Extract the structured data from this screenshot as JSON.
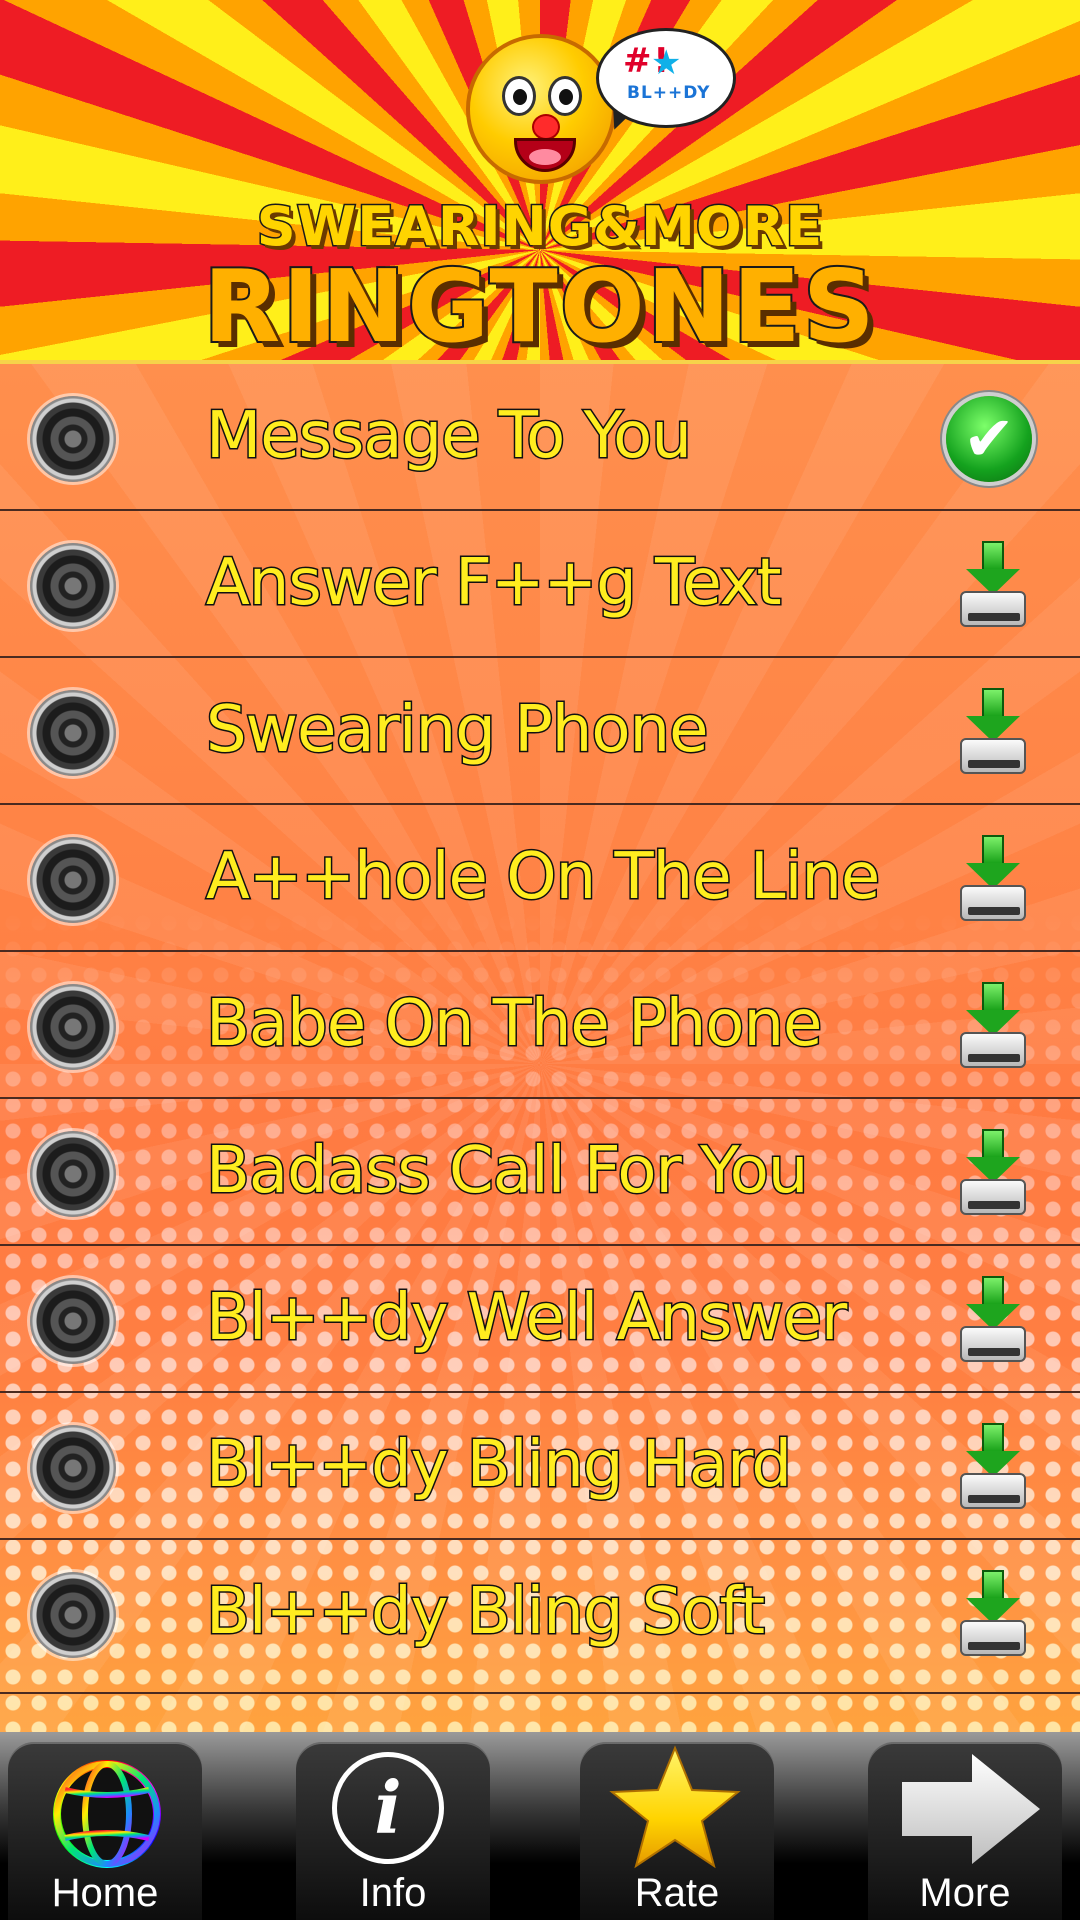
{
  "header": {
    "logo_line1": "SWEARING&MORE",
    "logo_line2": "RINGTONES",
    "bubble_symbols": "#!",
    "bubble_word": "BL++DY"
  },
  "ringtones": [
    {
      "title": "Message To You",
      "status": "selected",
      "icon": "check-icon"
    },
    {
      "title": "Answer F++g Text",
      "status": "download",
      "icon": "download-icon"
    },
    {
      "title": "Swearing Phone",
      "status": "download",
      "icon": "download-icon"
    },
    {
      "title": "A++hole On The Line",
      "status": "download",
      "icon": "download-icon"
    },
    {
      "title": "Babe On The Phone",
      "status": "download",
      "icon": "download-icon"
    },
    {
      "title": "Badass Call For You",
      "status": "download",
      "icon": "download-icon"
    },
    {
      "title": "Bl++dy Well Answer",
      "status": "download",
      "icon": "download-icon"
    },
    {
      "title": "Bl++dy Bling Hard",
      "status": "download",
      "icon": "download-icon"
    },
    {
      "title": "Bl++dy Bling Soft",
      "status": "download",
      "icon": "download-icon"
    }
  ],
  "tabs": [
    {
      "label": "Home",
      "icon": "globe-icon"
    },
    {
      "label": "Info",
      "icon": "info-icon"
    },
    {
      "label": "Rate",
      "icon": "star-icon"
    },
    {
      "label": "More",
      "icon": "arrow-right-icon"
    }
  ],
  "colors": {
    "title_text": "#ffed1f",
    "ray_red": "#ee1c24",
    "ray_orange": "#ffa300",
    "ray_yellow": "#ffef1a",
    "check_green": "#14a21e"
  }
}
